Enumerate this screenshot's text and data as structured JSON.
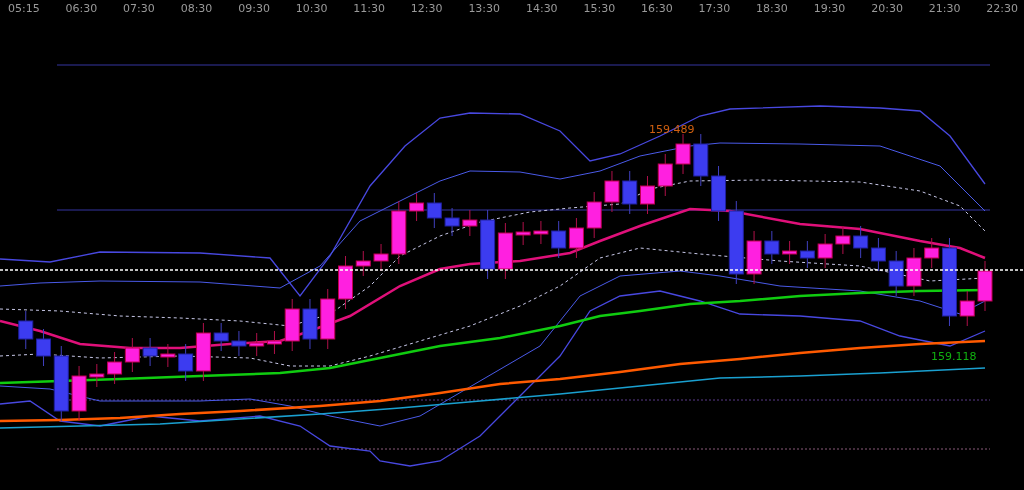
{
  "time_axis": {
    "labels": [
      "05:15",
      "06:30",
      "07:30",
      "08:30",
      "09:30",
      "10:30",
      "11:30",
      "12:30",
      "13:30",
      "14:30",
      "15:30",
      "16:30",
      "17:30",
      "18:30",
      "19:30",
      "20:30",
      "21:30",
      "22:30"
    ]
  },
  "annotations": [
    {
      "text": "159.489",
      "color": "#d06010"
    },
    {
      "text": "159.118",
      "color": "#10b010"
    }
  ]
}
